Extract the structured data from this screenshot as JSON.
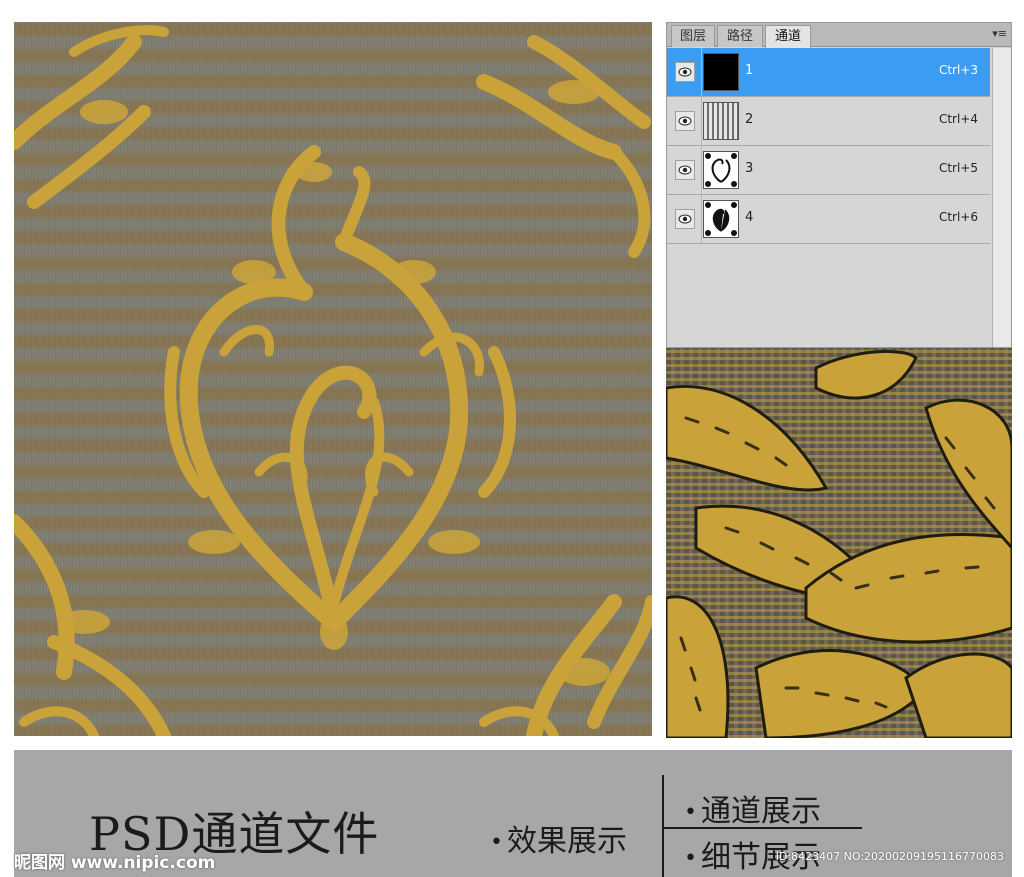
{
  "channels_panel": {
    "tabs": [
      {
        "label": "图层",
        "active": false
      },
      {
        "label": "路径",
        "active": false
      },
      {
        "label": "通道",
        "active": true
      }
    ],
    "menu_icon": "panel-menu-icon",
    "channels": [
      {
        "name": "1",
        "shortcut": "Ctrl+3",
        "selected": true,
        "thumbnail": "black"
      },
      {
        "name": "2",
        "shortcut": "Ctrl+4",
        "selected": false,
        "thumbnail": "stripes"
      },
      {
        "name": "3",
        "shortcut": "Ctrl+5",
        "selected": false,
        "thumbnail": "pattern"
      },
      {
        "name": "4",
        "shortcut": "Ctrl+6",
        "selected": false,
        "thumbnail": "pattern"
      }
    ]
  },
  "caption": {
    "title": "PSD通道文件",
    "effect_label": "效果展示",
    "channel_label": "通道展示",
    "detail_label": "细节展示",
    "bullet": "•"
  },
  "watermark": {
    "site": "昵图网 www.nipic.com",
    "id_text": "ID:8423407 NO:20200209195116770083"
  },
  "colors": {
    "ornament_gold": "#c9a23a",
    "background_grey": "#7d7a6e",
    "selection_blue": "#3b9cf4",
    "caption_bar": "#a7a7a7"
  }
}
